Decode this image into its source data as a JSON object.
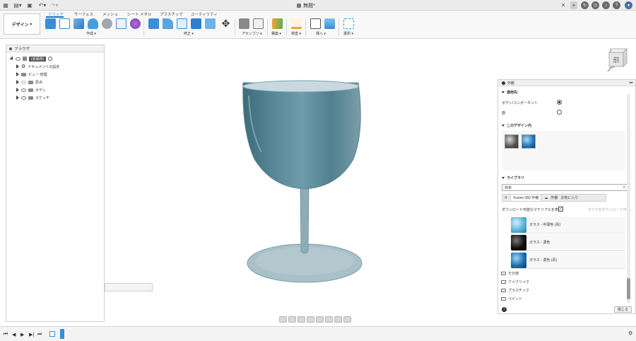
{
  "window": {
    "title": "無題*"
  },
  "toolbar": {
    "workspace": "デザイン",
    "tabs": [
      "ソリッド",
      "サーフェス",
      "メッシュ",
      "シート メタル",
      "プラスチック",
      "ユーティリティ"
    ],
    "groups": [
      "作成",
      "修正",
      "アセンブリ",
      "構築",
      "検査",
      "挿入",
      "選択"
    ]
  },
  "browser": {
    "title": "ブラウザ",
    "root": "(未保存)",
    "items": [
      "ドキュメントの設定",
      "ビュー-管理",
      "原点",
      "ボディ",
      "スケッチ"
    ]
  },
  "appearance": {
    "title": "外観",
    "apply_to": {
      "title": "適用先:",
      "options": [
        "ボディ/コンポーネント",
        "面"
      ],
      "selected": "ボディ/コンポーネント"
    },
    "in_design": {
      "title": "このデザイン内"
    },
    "library": {
      "title": "ライブラリ",
      "search_placeholder": "検索",
      "tabs": [
        "Fusion 360 外観",
        "外観",
        "お気に入り"
      ],
      "show_downloadable": "ダウンロード可能なマテリアルを表示",
      "download_all": "すべてのダウンロード可能...",
      "materials": [
        "ガラス - 中間色 (青)",
        "ガラス - 濃色",
        "ガラス - 濃色 (青)"
      ],
      "categories": [
        "その他",
        "ファブリック",
        "プラスチック",
        "ペイント"
      ]
    },
    "close_label": "閉じる"
  },
  "viewcube": {
    "face": "前"
  },
  "colors": {
    "accent": "#1a73c7",
    "glass": "#5a8696",
    "glass_light": "#8fb4c2"
  }
}
